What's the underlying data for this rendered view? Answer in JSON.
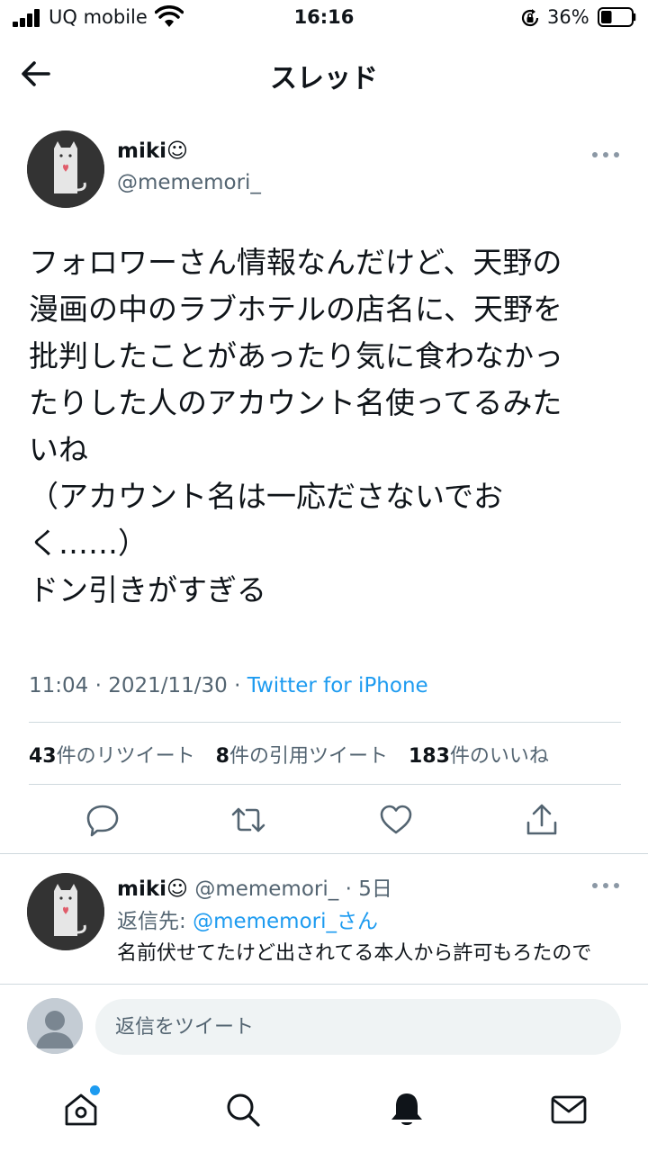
{
  "status_bar": {
    "carrier": "UQ mobile",
    "time": "16:16",
    "battery_percent": "36%",
    "battery_level": 0.36
  },
  "header": {
    "title": "スレッド"
  },
  "tweet": {
    "author_name": "miki☺",
    "author_handle": "@mememori_",
    "text": "フォロワーさん情報なんだけど、天野の\n漫画の中のラブホテルの店名に、天野を\n批判したことがあったり気に食わなかっ\nたりした人のアカウント名使ってるみた\nいね\n（アカウント名は一応ださないでお\nく……）\nドン引きがすぎる",
    "timestamp": "11:04 · 2021/11/30 · ",
    "source": "Twitter for iPhone",
    "stats": {
      "retweets_count": "43",
      "retweets_label": "件のリツイート",
      "quotes_count": "8",
      "quotes_label": "件の引用ツイート",
      "likes_count": "183",
      "likes_label": "件のいいね"
    }
  },
  "reply": {
    "author_name": "miki☺",
    "author_handle": " @mememori_",
    "time": " · 5日",
    "reply_to_label": "返信先: ",
    "reply_to_mention": "@mememori_さん",
    "text": "名前伏せてたけど出されてる本人から許可もろたので"
  },
  "composer": {
    "placeholder": "返信をツイート"
  },
  "colors": {
    "accent": "#1d9bf0",
    "secondary_text": "#536471",
    "divider": "#cfd9de"
  }
}
